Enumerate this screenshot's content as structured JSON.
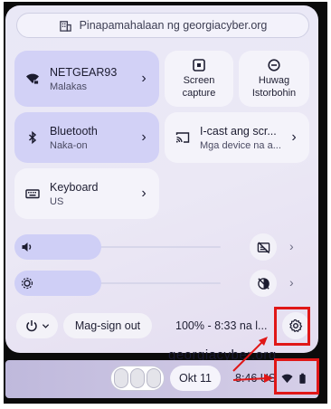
{
  "managed_banner": {
    "text": "Pinapamahalaan ng georgiacyber.org",
    "icon": "building-icon"
  },
  "tiles": {
    "wifi": {
      "title": "NETGEAR93",
      "subtitle": "Malakas",
      "icon": "wifi-lock-icon"
    },
    "bluetooth": {
      "title": "Bluetooth",
      "subtitle": "Naka-on",
      "icon": "bluetooth-icon"
    },
    "cast": {
      "title": "I-cast ang scr...",
      "subtitle": "Mga device na a...",
      "icon": "cast-icon"
    },
    "keyboard": {
      "title": "Keyboard",
      "subtitle": "US",
      "icon": "keyboard-icon"
    },
    "screen_capture": {
      "label_line1": "Screen",
      "label_line2": "capture",
      "icon": "screen-capture-icon"
    },
    "dnd": {
      "label_line1": "Huwag",
      "label_line2": "Istorbohin",
      "icon": "do-not-disturb-icon"
    }
  },
  "sliders": {
    "volume": {
      "level": 0.42,
      "icon": "volume-icon",
      "side_icon": "captions-off-icon"
    },
    "brightness": {
      "level": 0.42,
      "icon": "brightness-icon",
      "side_icon": "night-light-off-icon"
    }
  },
  "footer": {
    "power_icon": "power-icon",
    "signout_label": "Mag-sign out",
    "battery_text": "100% - 8:33 na l...",
    "settings_icon": "gear-icon"
  },
  "watermark": "georgiacyber.org",
  "shelf": {
    "date": "Okt 11",
    "time_locale": "8:46 US",
    "wifi_icon": "wifi-icon",
    "battery_icon": "battery-icon"
  },
  "colors": {
    "active_tile": "#d2d1f6",
    "highlight": "#e01717"
  }
}
